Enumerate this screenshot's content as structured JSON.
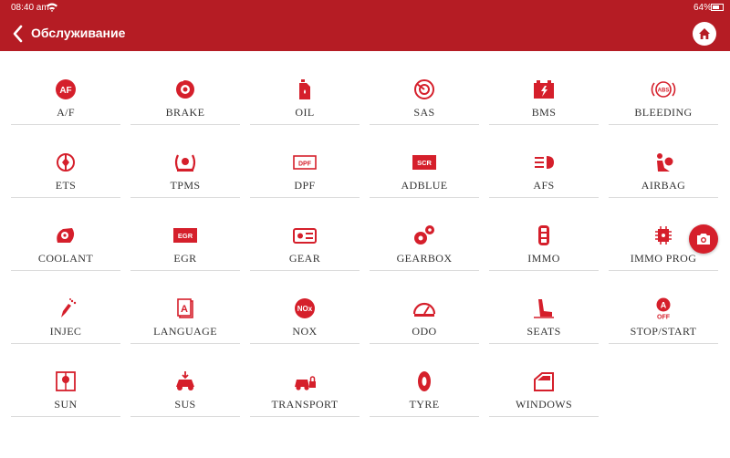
{
  "status": {
    "time": "08:40 am",
    "battery": "64%"
  },
  "header": {
    "title": "Обслуживание"
  },
  "functions": [
    {
      "label": "A/F",
      "icon": "af-icon"
    },
    {
      "label": "BRAKE",
      "icon": "brake-disc-icon"
    },
    {
      "label": "OIL",
      "icon": "oil-can-icon"
    },
    {
      "label": "SAS",
      "icon": "steering-angle-icon"
    },
    {
      "label": "BMS",
      "icon": "battery-icon"
    },
    {
      "label": "BLEEDING",
      "icon": "abs-icon"
    },
    {
      "label": "ETS",
      "icon": "throttle-icon"
    },
    {
      "label": "TPMS",
      "icon": "tire-pressure-icon"
    },
    {
      "label": "DPF",
      "icon": "dpf-icon"
    },
    {
      "label": "ADBLUE",
      "icon": "scr-icon"
    },
    {
      "label": "AFS",
      "icon": "headlight-icon"
    },
    {
      "label": "AIRBAG",
      "icon": "airbag-icon"
    },
    {
      "label": "COOLANT",
      "icon": "coolant-icon"
    },
    {
      "label": "EGR",
      "icon": "egr-icon"
    },
    {
      "label": "GEAR",
      "icon": "gear-sensor-icon"
    },
    {
      "label": "GEARBOX",
      "icon": "gearbox-icon"
    },
    {
      "label": "IMMO",
      "icon": "key-fob-icon"
    },
    {
      "label": "IMMO PROG",
      "icon": "chip-icon"
    },
    {
      "label": "INJEC",
      "icon": "injector-icon"
    },
    {
      "label": "LANGUAGE",
      "icon": "language-icon"
    },
    {
      "label": "NOX",
      "icon": "nox-icon"
    },
    {
      "label": "ODO",
      "icon": "odometer-icon"
    },
    {
      "label": "SEATS",
      "icon": "seat-icon"
    },
    {
      "label": "STOP/START",
      "icon": "stop-start-icon"
    },
    {
      "label": "SUN",
      "icon": "sunroof-icon"
    },
    {
      "label": "SUS",
      "icon": "suspension-icon"
    },
    {
      "label": "TRANSPORT",
      "icon": "transport-icon"
    },
    {
      "label": "TYRE",
      "icon": "tyre-icon"
    },
    {
      "label": "WINDOWS",
      "icon": "window-icon"
    }
  ],
  "colors": {
    "brand": "#b51c24",
    "icon": "#d51f2b"
  }
}
